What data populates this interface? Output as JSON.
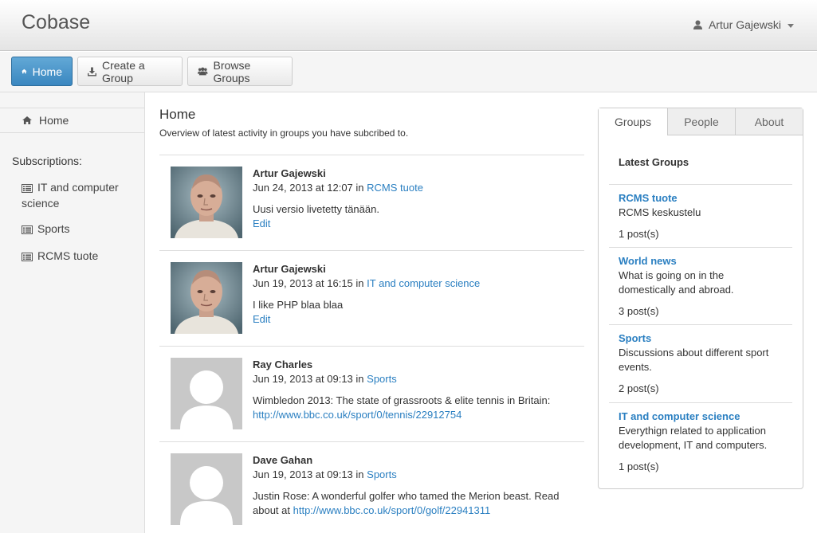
{
  "app": {
    "brand": "Cobase",
    "user_name": "Artur Gajewski"
  },
  "toolbar": {
    "home_label": "Home",
    "create_label": "Create a Group",
    "browse_label": "Browse Groups"
  },
  "sidebar": {
    "home_label": "Home",
    "subscriptions_title": "Subscriptions:",
    "items": [
      {
        "label": "IT and computer science"
      },
      {
        "label": "Sports"
      },
      {
        "label": "RCMS tuote"
      }
    ]
  },
  "main": {
    "title": "Home",
    "overview": "Overview of latest activity in groups you have subcribed to.",
    "posts": [
      {
        "author": "Artur Gajewski",
        "date": "Jun 24, 2013 at 12:07",
        "in_word": "in",
        "group": "RCMS tuote",
        "text": "Uusi versio livetetty tänään.",
        "edit": "Edit",
        "avatar": "photo"
      },
      {
        "author": "Artur Gajewski",
        "date": "Jun 19, 2013 at 16:15",
        "in_word": "in",
        "group": "IT and computer science",
        "text": "I like PHP blaa blaa",
        "edit": "Edit",
        "avatar": "photo"
      },
      {
        "author": "Ray Charles",
        "date": "Jun 19, 2013 at 09:13",
        "in_word": "in",
        "group": "Sports",
        "text": "Wimbledon 2013: The state of grassroots & elite tennis in Britain:",
        "link": "http://www.bbc.co.uk/sport/0/tennis/22912754",
        "avatar": "placeholder"
      },
      {
        "author": "Dave Gahan",
        "date": "Jun 19, 2013 at 09:13",
        "in_word": "in",
        "group": "Sports",
        "text": "Justin Rose: A wonderful golfer who tamed the Merion beast. Read about at",
        "link": "http://www.bbc.co.uk/sport/0/golf/22941311",
        "avatar": "placeholder"
      }
    ]
  },
  "panel": {
    "tabs": [
      {
        "label": "Groups"
      },
      {
        "label": "People"
      },
      {
        "label": "About"
      }
    ],
    "title": "Latest Groups",
    "groups": [
      {
        "name": "RCMS tuote",
        "desc": "RCMS keskustelu",
        "count": "1 post(s)"
      },
      {
        "name": "World news",
        "desc": "What is going on in the domestically and abroad.",
        "count": "3 post(s)"
      },
      {
        "name": "Sports",
        "desc": "Discussions about different sport events.",
        "count": "2 post(s)"
      },
      {
        "name": "IT and computer science",
        "desc": "Everythign related to application development, IT and computers.",
        "count": "1 post(s)"
      }
    ]
  },
  "colors": {
    "link": "#2a7fc1",
    "primary_button": "#3a87c0",
    "avatar_placeholder": "#c8c8c8"
  },
  "icons": {
    "user": "user-icon",
    "home": "home-icon",
    "download": "download-icon",
    "group": "group-icon",
    "list": "list-icon"
  }
}
